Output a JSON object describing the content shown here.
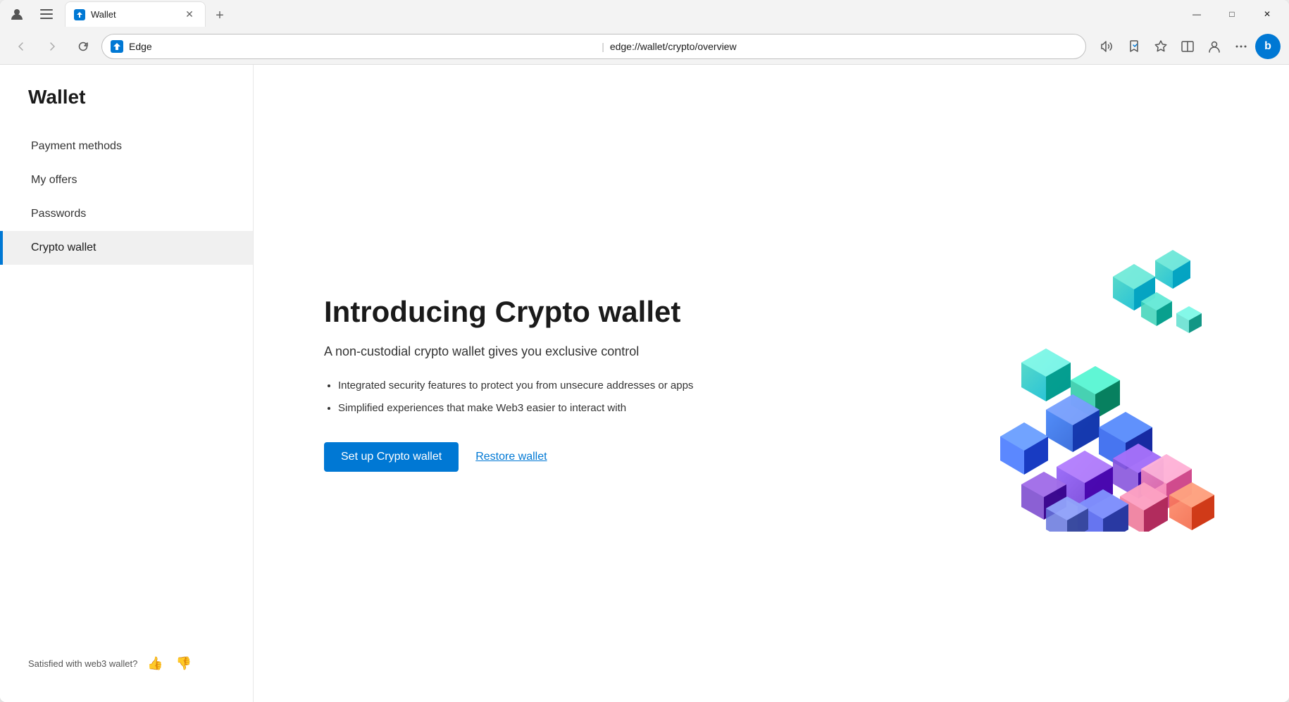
{
  "browser": {
    "tab": {
      "title": "Wallet",
      "url": "edge://wallet/crypto/overview"
    },
    "address_bar": {
      "favicon_label": "edge-logo",
      "browser_name": "Edge",
      "separator": "|",
      "url": "edge://wallet/crypto/overview"
    },
    "window_controls": {
      "minimize": "—",
      "maximize": "□",
      "close": "✕"
    }
  },
  "sidebar": {
    "title": "Wallet",
    "nav_items": [
      {
        "id": "payment-methods",
        "label": "Payment methods",
        "active": false
      },
      {
        "id": "my-offers",
        "label": "My offers",
        "active": false
      },
      {
        "id": "passwords",
        "label": "Passwords",
        "active": false
      },
      {
        "id": "crypto-wallet",
        "label": "Crypto wallet",
        "active": true
      }
    ],
    "footer": {
      "satisfaction_text": "Satisfied with web3 wallet?",
      "thumbs_up": "👍",
      "thumbs_down": "👎"
    }
  },
  "main": {
    "intro_title": "Introducing Crypto wallet",
    "intro_subtitle": "A non-custodial crypto wallet gives you exclusive control",
    "features": [
      "Integrated security features to protect you from unsecure addresses or apps",
      "Simplified experiences that make Web3 easier to interact with"
    ],
    "setup_button": "Set up Crypto wallet",
    "restore_button": "Restore wallet"
  },
  "toolbar": {
    "icons": [
      "read-aloud",
      "favorites-collections",
      "add-favorites",
      "split-screen",
      "profile",
      "more-options"
    ]
  }
}
